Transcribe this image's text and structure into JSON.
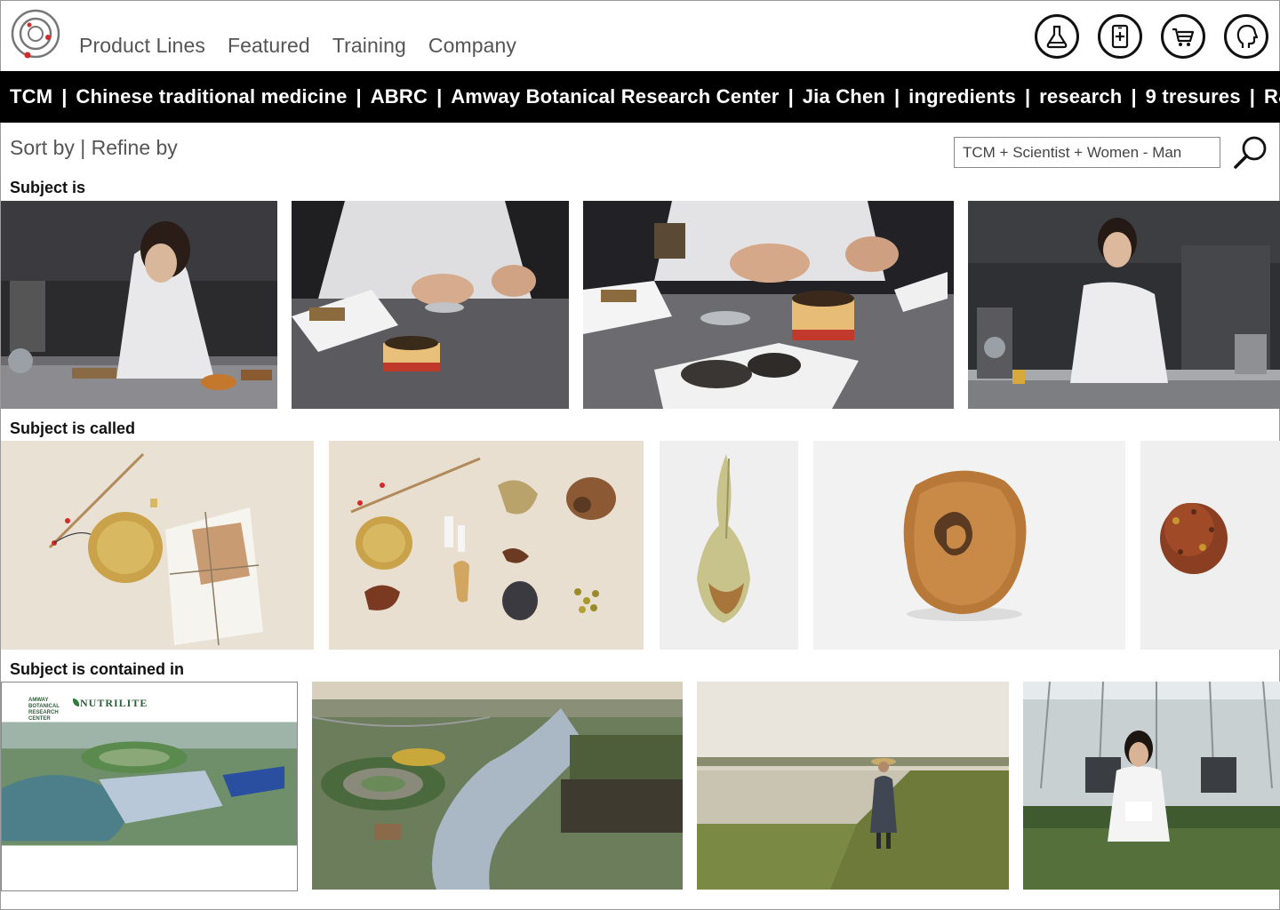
{
  "nav": {
    "items": [
      "Product Lines",
      "Featured",
      "Training",
      "Company"
    ]
  },
  "header_icons": [
    "flask-icon",
    "tablet-plus-icon",
    "shopping-cart-icon",
    "profile-head-icon"
  ],
  "tags": [
    "TCM",
    "Chinese traditional medicine",
    "ABRC",
    "Amway Botanical Research Center",
    "Jia Chen",
    "ingredients",
    "research",
    "9 tresures",
    "R&D"
  ],
  "sort": {
    "sort_label": "Sort by",
    "divider": "|",
    "refine_label": "Refine by"
  },
  "search": {
    "value": "TCM + Scientist + Women - Man"
  },
  "sections": [
    {
      "label": "Subject is"
    },
    {
      "label": "Subject is called"
    },
    {
      "label": "Subject is contained in"
    }
  ],
  "brand_print": {
    "org": "AMWAY BOTANICAL RESEARCH CENTER",
    "brand": "NUTRILITE"
  },
  "colors": {
    "accent": "#d42a2a",
    "bar": "#000000",
    "text": "#555555"
  }
}
